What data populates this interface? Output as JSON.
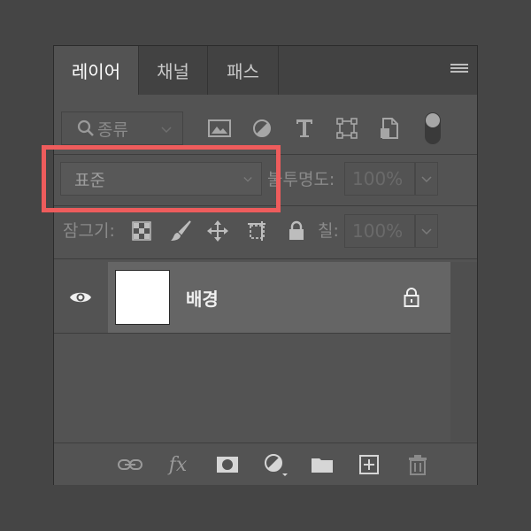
{
  "tabs": [
    {
      "label": "레이어",
      "active": true
    },
    {
      "label": "채널",
      "active": false
    },
    {
      "label": "패스",
      "active": false
    }
  ],
  "filter": {
    "label": "종류"
  },
  "blend": {
    "mode": "표준"
  },
  "opacity": {
    "label": "불투명도:",
    "value": "100%"
  },
  "lock": {
    "label": "잠그기:"
  },
  "fill": {
    "label": "칠:",
    "value": "100%"
  },
  "layer": {
    "name": "배경"
  },
  "footer": {
    "fx": "fx"
  },
  "colors": {
    "highlight": "#ee5c5c",
    "panel": "#535353",
    "selected_row": "#656565"
  }
}
